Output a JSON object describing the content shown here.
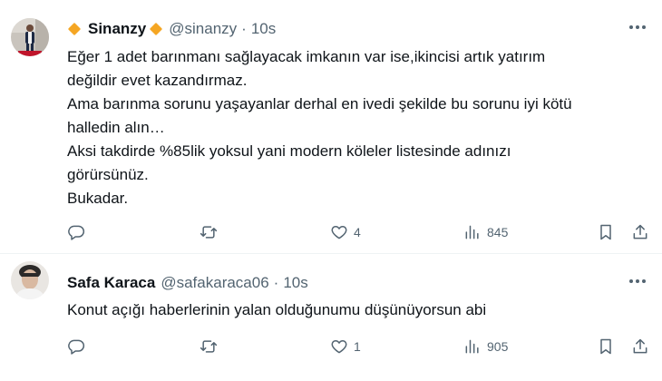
{
  "tweets": [
    {
      "author_name": "Sinanzy",
      "handle": "@sinanzy",
      "separator": "·",
      "time": "10s",
      "text": "Eğer 1 adet barınmanı sağlayacak imkanın var ise,ikincisi artık yatırım\ndeğildir evet kazandırmaz.\nAma barınma sorunu yaşayanlar derhal en ivedi şekilde bu sorunu iyi kötü\nhalledin alın…\nAksi takdirde %85lik yoksul yani modern köleler listesinde adınızı\ngörürsünüz.\nBukadar.",
      "stats": {
        "replies": "",
        "retweets": "",
        "likes": "4",
        "views": "845"
      }
    },
    {
      "author_name": "Safa Karaca",
      "handle": "@safakaraca06",
      "separator": "·",
      "time": "10s",
      "text": "Konut açığı haberlerinin yalan olduğunumu düşünüyorsun abi",
      "stats": {
        "replies": "",
        "retweets": "",
        "likes": "1",
        "views": "905"
      }
    }
  ],
  "icons": {
    "reply": "reply-icon",
    "retweet": "retweet-icon",
    "like": "heart-icon",
    "views": "views-icon",
    "bookmark": "bookmark-icon",
    "share": "share-icon",
    "more": "more-icon",
    "badge": "gold-diamond-icon"
  },
  "colors": {
    "text": "#0f1419",
    "secondary": "#536471",
    "badge": "#f5a623",
    "divider": "#eff3f4"
  }
}
